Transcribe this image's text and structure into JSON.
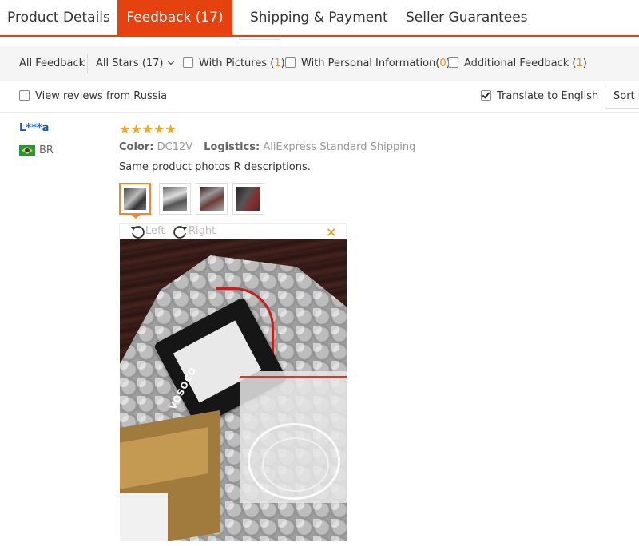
{
  "tabs": [
    {
      "label": "Product Details"
    },
    {
      "label": "Feedback (17)",
      "active": true
    },
    {
      "label": "Shipping & Payment"
    },
    {
      "label": "Seller Guarantees"
    }
  ],
  "filters": {
    "all_feedback": "All Feedback",
    "all_stars": "All Stars (17)",
    "with_pictures": {
      "label": "With Pictures (",
      "count": "1",
      "suffix": ")"
    },
    "with_personal_info": {
      "label": "With Personal Information(",
      "count": "0",
      "suffix": ")"
    },
    "additional_feedback": {
      "label": "Additional Feedback (",
      "count": "1",
      "suffix": ")"
    },
    "view_reviews_from": "View reviews from Russia",
    "translate": "Translate to English",
    "translate_checked": true,
    "sort": "Sort by"
  },
  "review": {
    "user": "L***a",
    "country": "BR",
    "stars": "★★★★★",
    "rating": 5,
    "color_label": "Color:",
    "color_value": "DC12V",
    "logistics_label": "Logistics:",
    "logistics_value": "AliExpress Standard Shipping",
    "text": "Same product photos R descriptions.",
    "thumbnail_count": 4,
    "active_thumbnail": 0
  },
  "viewer": {
    "rotate_left": "Left",
    "rotate_right": "Right",
    "close": "×",
    "photo_brand_text": "VOSOCO"
  },
  "colors": {
    "accent": "#e64210",
    "star": "#f5a623",
    "count_highlight": "#f08a24",
    "username": "#0a5bb5"
  }
}
